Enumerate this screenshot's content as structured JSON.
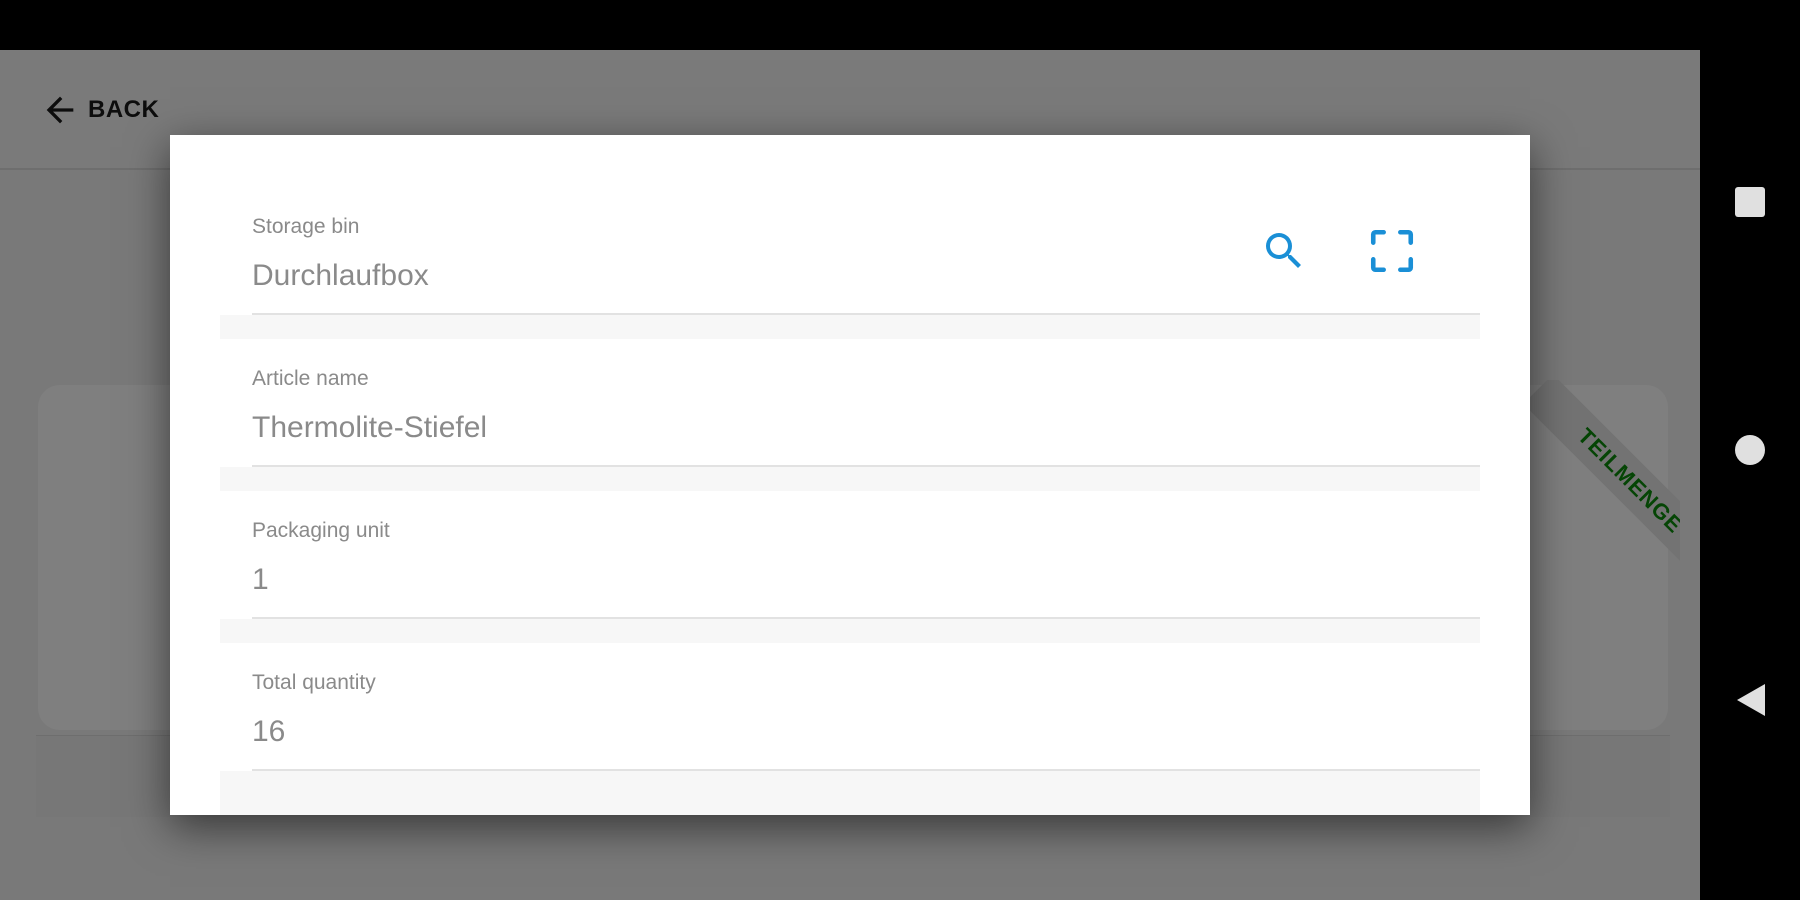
{
  "header": {
    "back_label": "BACK",
    "back_icon": "arrow-left-icon"
  },
  "background_card": {
    "ribbon_label": "TEILMENGE",
    "ribbon_color": "#0a8a0a"
  },
  "dialog": {
    "fields": [
      {
        "label": "Storage bin",
        "value": "Durchlaufbox"
      },
      {
        "label": "Article name",
        "value": "Thermolite-Stiefel"
      },
      {
        "label": "Packaging unit",
        "value": "1"
      },
      {
        "label": "Total quantity",
        "value": "16"
      }
    ],
    "search_icon": "search-icon",
    "scan_icon": "scan-barcode-icon",
    "accent_color": "#1a8fd6"
  },
  "navigation_bar": {
    "recents_icon": "square-icon",
    "home_icon": "circle-icon",
    "back_icon": "triangle-back-icon"
  }
}
